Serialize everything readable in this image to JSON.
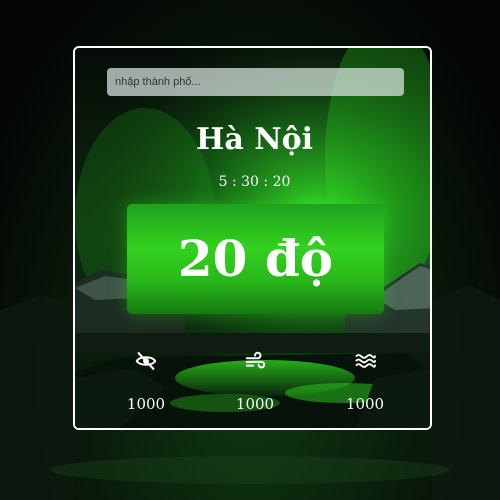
{
  "search": {
    "placeholder": "nhập thành phố..."
  },
  "location": {
    "city": "Hà Nội"
  },
  "clock": {
    "time": "5 : 30 : 20"
  },
  "weather": {
    "temperature": "20 độ"
  },
  "stats": [
    {
      "icon": "eye-slash-icon",
      "value": "1000"
    },
    {
      "icon": "wind-icon",
      "value": "1000"
    },
    {
      "icon": "waves-icon",
      "value": "1000"
    }
  ],
  "colors": {
    "accent": "#2fd11e",
    "card_border": "#ffffff",
    "text": "#ffffff"
  }
}
